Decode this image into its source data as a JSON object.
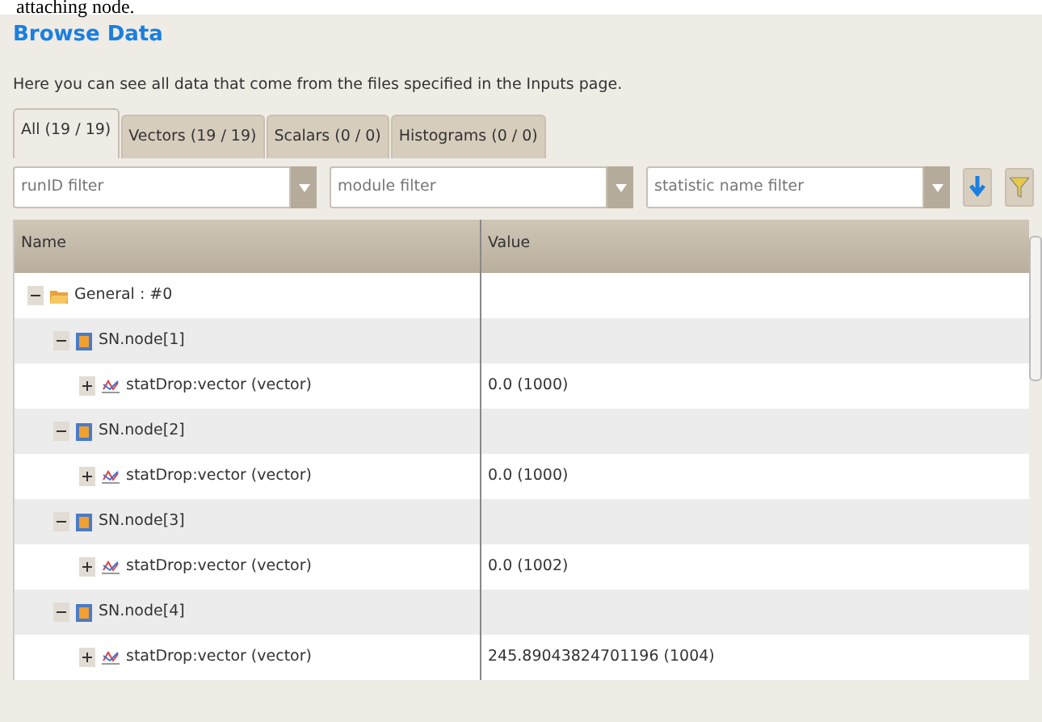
{
  "document_text": "attaching node.",
  "panel": {
    "title": "Browse Data",
    "description": "Here you can see all data that come from the files specified in the Inputs page."
  },
  "tabs": [
    {
      "label": "All (19 / 19)",
      "selected": true
    },
    {
      "label": "Vectors (19 / 19)",
      "selected": false
    },
    {
      "label": "Scalars (0 / 0)",
      "selected": false
    },
    {
      "label": "Histograms (0 / 0)",
      "selected": false
    }
  ],
  "filters": [
    {
      "placeholder": "runID filter"
    },
    {
      "placeholder": "module filter"
    },
    {
      "placeholder": "statistic name filter"
    }
  ],
  "table": {
    "columns": [
      "Name",
      "Value"
    ],
    "rows": [
      {
        "kind": "run",
        "name": "General : #0",
        "expanded": true,
        "children": [
          {
            "kind": "module",
            "name": "SN.node[1]",
            "expanded": true,
            "children": [
              {
                "kind": "vector",
                "name": "statDrop:vector (vector)",
                "value": "0.0 (1000)",
                "expanded": false
              }
            ]
          },
          {
            "kind": "module",
            "name": "SN.node[2]",
            "expanded": true,
            "children": [
              {
                "kind": "vector",
                "name": "statDrop:vector (vector)",
                "value": "0.0 (1000)",
                "expanded": false
              }
            ]
          },
          {
            "kind": "module",
            "name": "SN.node[3]",
            "expanded": true,
            "children": [
              {
                "kind": "vector",
                "name": "statDrop:vector (vector)",
                "value": "0.0 (1002)",
                "expanded": false
              }
            ]
          },
          {
            "kind": "module",
            "name": "SN.node[4]",
            "expanded": true,
            "children": [
              {
                "kind": "vector",
                "name": "statDrop:vector (vector)",
                "value": "245.89043824701196 (1004)",
                "expanded": false
              }
            ]
          }
        ]
      }
    ]
  }
}
